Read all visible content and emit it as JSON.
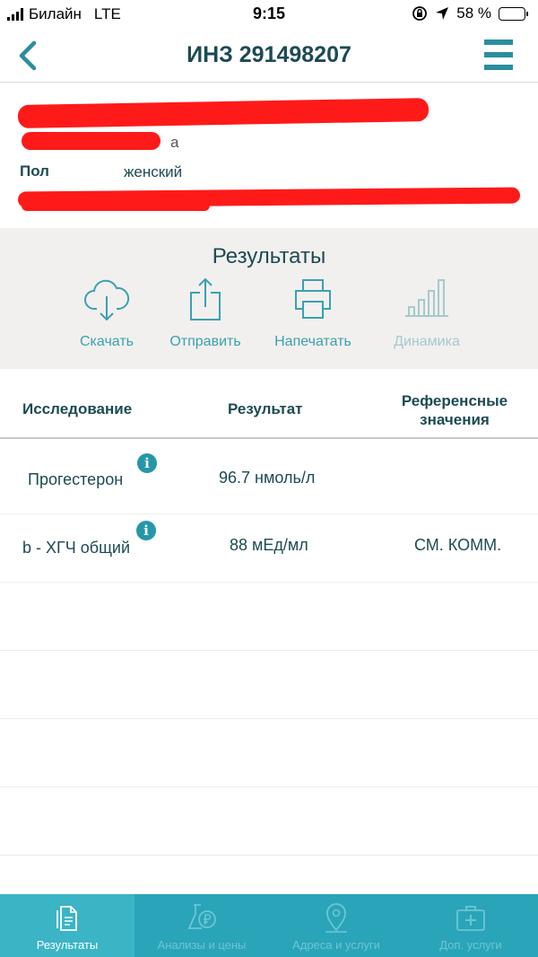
{
  "status_bar": {
    "carrier": "Билайн",
    "network": "LTE",
    "time": "9:15",
    "battery": "58 %",
    "battery_level": 0.58
  },
  "header": {
    "title": "ИНЗ 291498207"
  },
  "patient": {
    "gender_label": "Пол",
    "gender_value": "женский",
    "name_tail": "а"
  },
  "results": {
    "heading": "Результаты",
    "actions": [
      {
        "label": "Скачать",
        "icon": "cloud-download-icon"
      },
      {
        "label": "Отправить",
        "icon": "share-icon"
      },
      {
        "label": "Напечатать",
        "icon": "printer-icon"
      },
      {
        "label": "Динамика",
        "icon": "bar-chart-icon"
      }
    ]
  },
  "table": {
    "headers": {
      "study": "Исследование",
      "result": "Результат",
      "reference": "Референсные значения"
    },
    "rows": [
      {
        "study": "Прогестерон",
        "result": "96.7 нмоль/л",
        "reference": ""
      },
      {
        "study": "b - ХГЧ общий",
        "result": "88 мЕд/мл",
        "reference": "СМ. КОММ."
      }
    ]
  },
  "tabbar": [
    {
      "label": "Результаты",
      "icon": "documents-icon"
    },
    {
      "label": "Анализы и цены",
      "icon": "flask-ruble-icon"
    },
    {
      "label": "Адреса и услуги",
      "icon": "map-pin-icon"
    },
    {
      "label": "Доп. услуги",
      "icon": "medical-kit-icon"
    }
  ],
  "colors": {
    "accent": "#2aa4b8",
    "text": "#1d4a52",
    "panel": "#f1f0ee",
    "redaction": "#ff1a1a"
  }
}
